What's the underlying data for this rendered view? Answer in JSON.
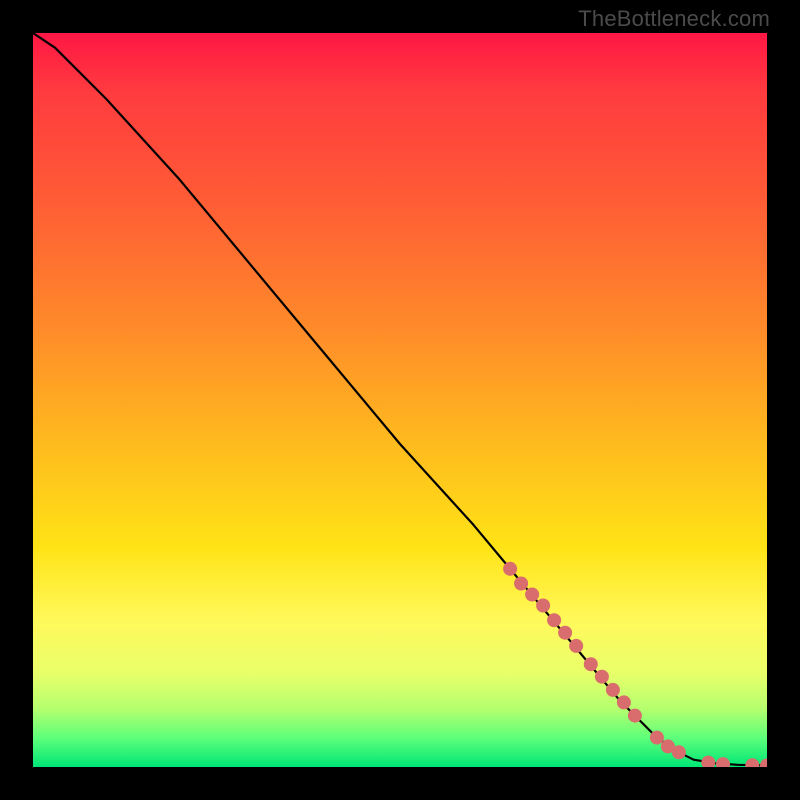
{
  "watermark": "TheBottleneck.com",
  "colors": {
    "frame": "#000000",
    "curve": "#000000",
    "dot": "#d96d6d",
    "gradient_top": "#ff1744",
    "gradient_bottom": "#00e676"
  },
  "chart_data": {
    "type": "line",
    "title": "",
    "xlabel": "",
    "ylabel": "",
    "xlim": [
      0,
      100
    ],
    "ylim": [
      0,
      100
    ],
    "grid": false,
    "series": [
      {
        "name": "bottleneck-curve",
        "x": [
          0,
          3,
          6,
          10,
          20,
          30,
          40,
          50,
          60,
          70,
          75,
          80,
          85,
          88,
          90,
          93,
          96,
          100
        ],
        "y": [
          100,
          98,
          95,
          91,
          80,
          68,
          56,
          44,
          33,
          21,
          15,
          9,
          4,
          2,
          1,
          0.5,
          0.3,
          0.2
        ]
      }
    ],
    "markers": [
      {
        "x": 65,
        "y": 27
      },
      {
        "x": 66.5,
        "y": 25
      },
      {
        "x": 68,
        "y": 23.5
      },
      {
        "x": 69.5,
        "y": 22
      },
      {
        "x": 71,
        "y": 20
      },
      {
        "x": 72.5,
        "y": 18.3
      },
      {
        "x": 74,
        "y": 16.5
      },
      {
        "x": 76,
        "y": 14
      },
      {
        "x": 77.5,
        "y": 12.3
      },
      {
        "x": 79,
        "y": 10.5
      },
      {
        "x": 80.5,
        "y": 8.8
      },
      {
        "x": 82,
        "y": 7
      },
      {
        "x": 85,
        "y": 4
      },
      {
        "x": 86.5,
        "y": 2.8
      },
      {
        "x": 88,
        "y": 2
      },
      {
        "x": 92,
        "y": 0.6
      },
      {
        "x": 94,
        "y": 0.4
      },
      {
        "x": 98,
        "y": 0.25
      },
      {
        "x": 100,
        "y": 0.2
      }
    ]
  }
}
